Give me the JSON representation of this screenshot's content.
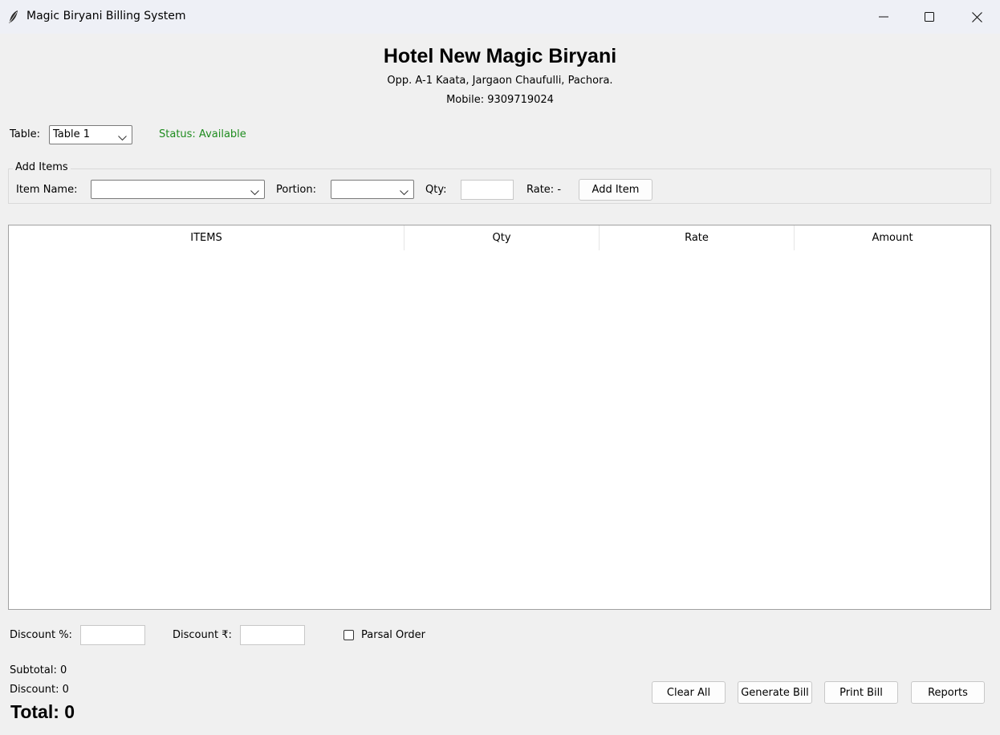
{
  "window": {
    "title": "Magic Biryani Billing System",
    "icons": [
      "feather-icon",
      "minimize-icon",
      "maximize-icon",
      "close-icon"
    ]
  },
  "header": {
    "hotel_name": "Hotel New Magic Biryani",
    "address": "Opp. A-1 Kaata, Jargaon Chaufulli, Pachora.",
    "mobile": "Mobile: 9309719024"
  },
  "table_select": {
    "label": "Table:",
    "value": "Table 1",
    "status": "Status: Available",
    "status_color": "#1e8c1e"
  },
  "add_items": {
    "group_title": "Add Items",
    "item_name_label": "Item Name:",
    "item_name_value": "",
    "portion_label": "Portion:",
    "portion_value": "",
    "qty_label": "Qty:",
    "qty_value": "",
    "rate_label": "Rate: -",
    "add_button": "Add Item"
  },
  "items_table": {
    "columns": [
      "ITEMS",
      "Qty",
      "Rate",
      "Amount"
    ],
    "rows": []
  },
  "discount": {
    "percent_label": "Discount %:",
    "percent_value": "",
    "amount_label": "Discount ₹:",
    "amount_value": "",
    "parsal_label": "Parsal Order",
    "parsal_checked": false
  },
  "summary": {
    "subtotal": "Subtotal: 0",
    "discount": "Discount: 0",
    "total": "Total: 0"
  },
  "actions": {
    "clear_all": "Clear All",
    "generate_bill": "Generate Bill",
    "print_bill": "Print Bill",
    "reports": "Reports"
  }
}
